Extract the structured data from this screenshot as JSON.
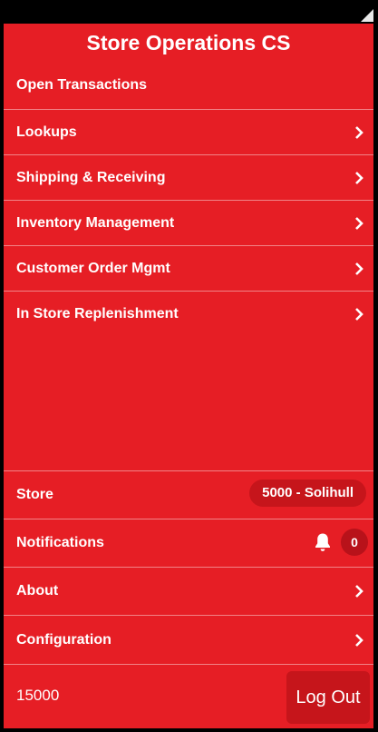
{
  "app": {
    "title": "Store Operations CS"
  },
  "menu": {
    "items": [
      {
        "label": "Open Transactions",
        "has_chevron": false
      },
      {
        "label": "Lookups",
        "has_chevron": true
      },
      {
        "label": "Shipping & Receiving",
        "has_chevron": true
      },
      {
        "label": "Inventory Management",
        "has_chevron": true
      },
      {
        "label": "Customer Order Mgmt",
        "has_chevron": true
      },
      {
        "label": "In Store Replenishment",
        "has_chevron": true
      }
    ]
  },
  "bottom": {
    "store_label": "Store",
    "store_value": "5000 - Solihull",
    "notifications_label": "Notifications",
    "notifications_count": "0",
    "about_label": "About",
    "configuration_label": "Configuration"
  },
  "footer": {
    "user_id": "15000",
    "logout_label": "Log Out"
  },
  "colors": {
    "background": "#e61e25",
    "pill": "#c6151b",
    "badge": "#b8121a",
    "text": "#ffffff"
  },
  "icons": {
    "chevron": "chevron-right-icon",
    "bell": "bell-icon",
    "signal": "signal-icon"
  }
}
